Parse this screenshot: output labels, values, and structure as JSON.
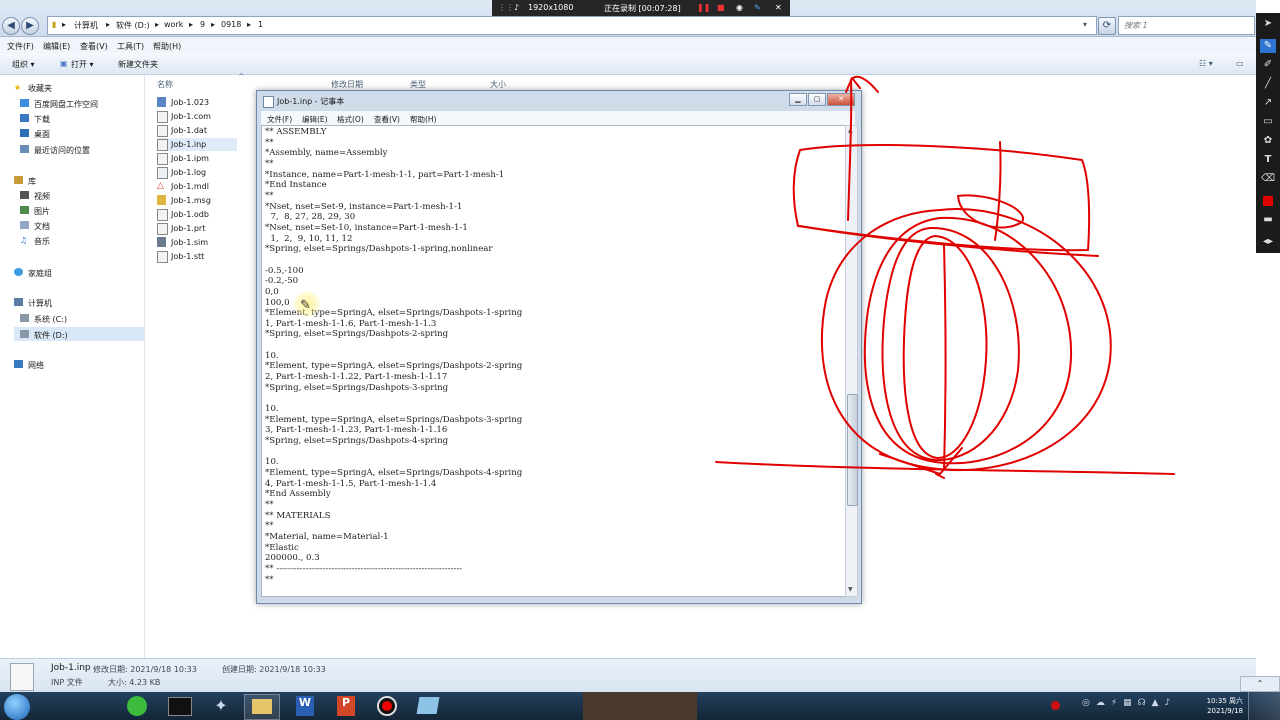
{
  "explorer": {
    "address": {
      "segments": [
        "计算机",
        "软件 (D:)",
        "work",
        "9",
        "0918",
        "1"
      ],
      "separator": "▸"
    },
    "search_placeholder": "搜索 1",
    "menu": [
      "文件(F)",
      "编辑(E)",
      "查看(V)",
      "工具(T)",
      "帮助(H)"
    ],
    "toolbar": {
      "organize": "组织 ▾",
      "open": "打开 ▾",
      "new_folder": "新建文件夹"
    },
    "nav": {
      "favorites": "收藏夹",
      "fav_items": [
        "百度网盘工作空间",
        "下载",
        "桌面",
        "最近访问的位置"
      ],
      "libraries": "库",
      "lib_items": [
        "视频",
        "图片",
        "文档",
        "音乐"
      ],
      "homegroup": "家庭组",
      "computer": "计算机",
      "drives": [
        "系统 (C:)",
        "软件 (D:)"
      ],
      "network": "网络"
    },
    "columns": {
      "name": "名称",
      "modified": "修改日期",
      "type": "类型",
      "size": "大小"
    },
    "files": [
      "Job-1.023",
      "Job-1.com",
      "Job-1.dat",
      "Job-1.inp",
      "Job-1.ipm",
      "Job-1.log",
      "Job-1.mdl",
      "Job-1.msg",
      "Job-1.odb",
      "Job-1.prt",
      "Job-1.sim",
      "Job-1.stt"
    ],
    "selected_file": "Job-1.inp",
    "details": {
      "file_name": "Job-1.inp",
      "modified_label": "修改日期: 2021/9/18 10:33",
      "created_label": "创建日期: 2021/9/18 10:33",
      "file_type": "INP 文件",
      "size_label": "大小: 4.23 KB"
    }
  },
  "recorder": {
    "resolution": "1920x1080",
    "status": "正在录制 [00:07:28]"
  },
  "notepad": {
    "title": "Job-1.inp - 记事本",
    "menu": [
      "文件(F)",
      "编辑(E)",
      "格式(O)",
      "查看(V)",
      "帮助(H)"
    ],
    "lines": [
      "** ASSEMBLY",
      "**",
      "*Assembly, name=Assembly",
      "**",
      "*Instance, name=Part-1-mesh-1-1, part=Part-1-mesh-1",
      "*End Instance",
      "**",
      "*Nset, nset=Set-9, instance=Part-1-mesh-1-1",
      "  7,  8, 27, 28, 29, 30",
      "*Nset, nset=Set-10, instance=Part-1-mesh-1-1",
      "  1,  2,  9, 10, 11, 12",
      "*Spring, elset=Springs/Dashpots-1-spring,nonlinear",
      "",
      "-0.5,-100",
      "-0.2,-50",
      "0,0",
      "100,0",
      "*Element, type=SpringA, elset=Springs/Dashpots-1-spring",
      "1, Part-1-mesh-1-1.6, Part-1-mesh-1-1.3",
      "*Spring, elset=Springs/Dashpots-2-spring",
      "",
      "10.",
      "*Element, type=SpringA, elset=Springs/Dashpots-2-spring",
      "2, Part-1-mesh-1-1.22, Part-1-mesh-1-1.17",
      "*Spring, elset=Springs/Dashpots-3-spring",
      "",
      "10.",
      "*Element, type=SpringA, elset=Springs/Dashpots-3-spring",
      "3, Part-1-mesh-1-1.23, Part-1-mesh-1-1.16",
      "*Spring, elset=Springs/Dashpots-4-spring",
      "",
      "10.",
      "*Element, type=SpringA, elset=Springs/Dashpots-4-spring",
      "4, Part-1-mesh-1-1.5, Part-1-mesh-1-1.4",
      "*End Assembly",
      "**",
      "** MATERIALS",
      "**",
      "*Material, name=Material-1",
      "*Elastic",
      "200000., 0.3",
      "** ----------------------------------------------------------------",
      "**"
    ]
  },
  "clock": {
    "time": "10:35 周六",
    "date": "2021/9/18"
  },
  "colors": {
    "annotation": "#e00000",
    "taskbar": "#1c3450",
    "explorer_chrome": "#dbe6f3"
  },
  "icons": [
    "back-icon",
    "forward-icon",
    "refresh-icon",
    "pen-icon",
    "record-icon",
    "stop-icon",
    "camera-icon",
    "close-icon",
    "start-orb-icon"
  ]
}
